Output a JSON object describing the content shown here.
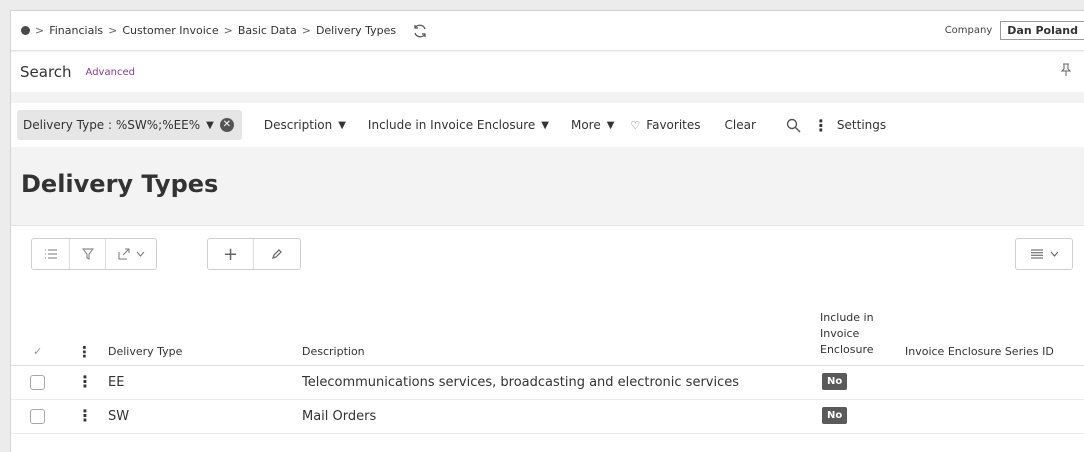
{
  "breadcrumb": {
    "items": [
      "Financials",
      "Customer Invoice",
      "Basic Data",
      "Delivery Types"
    ]
  },
  "company": {
    "label": "Company",
    "value": "Dan Poland"
  },
  "search": {
    "title": "Search",
    "advanced": "Advanced"
  },
  "filters": {
    "active_chip": "Delivery Type : %SW%;%EE%",
    "items": [
      "Description",
      "Include in Invoice Enclosure",
      "More"
    ],
    "favorites": "Favorites",
    "clear": "Clear",
    "settings": "Settings"
  },
  "page": {
    "title": "Delivery Types"
  },
  "table": {
    "columns": {
      "delivery_type": "Delivery Type",
      "description": "Description",
      "include_line1": "Include in",
      "include_line2": "Invoice",
      "include_line3": "Enclosure",
      "series": "Invoice Enclosure Series ID"
    },
    "rows": [
      {
        "delivery_type": "EE",
        "description": "Telecommunications services, broadcasting and electronic services",
        "include": "No"
      },
      {
        "delivery_type": "SW",
        "description": "Mail Orders",
        "include": "No"
      }
    ]
  },
  "colors": {
    "accent_link": "#8a3b8f",
    "badge": "#5a5a5a"
  }
}
